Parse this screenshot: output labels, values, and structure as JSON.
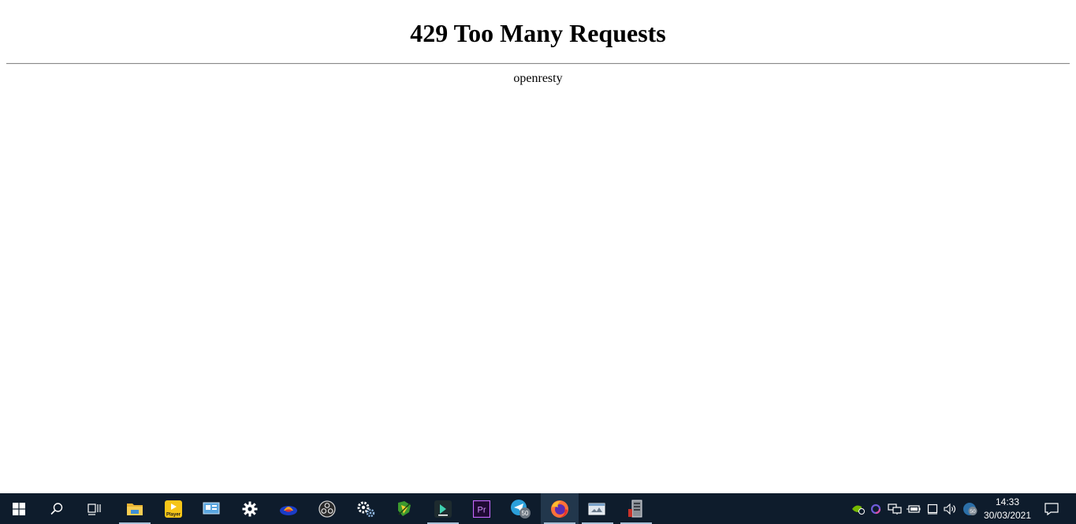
{
  "page": {
    "heading": "429 Too Many Requests",
    "server": "openresty"
  },
  "taskbar": {
    "apps": [
      {
        "name": "start-icon"
      },
      {
        "name": "search-icon"
      },
      {
        "name": "task-view-icon"
      },
      {
        "name": "file-explorer-icon"
      },
      {
        "name": "player-icon",
        "label": "Player"
      },
      {
        "name": "control-panel-icon"
      },
      {
        "name": "settings-gear-icon"
      },
      {
        "name": "app-icon"
      },
      {
        "name": "obs-icon"
      },
      {
        "name": "gears-icon"
      },
      {
        "name": "app-icon"
      },
      {
        "name": "filmora-icon"
      },
      {
        "name": "premiere-pro-icon",
        "label": "Pr"
      },
      {
        "name": "telegram-icon",
        "badge": "50"
      },
      {
        "name": "firefox-icon"
      },
      {
        "name": "app-window-icon"
      },
      {
        "name": "server-tower-icon"
      }
    ],
    "tray": {
      "badge": "50",
      "time": "14:33",
      "date": "30/03/2021"
    },
    "colors": {
      "background": "#0e1c2c",
      "active": "#22374c",
      "underline": "#a7bfd6"
    }
  }
}
